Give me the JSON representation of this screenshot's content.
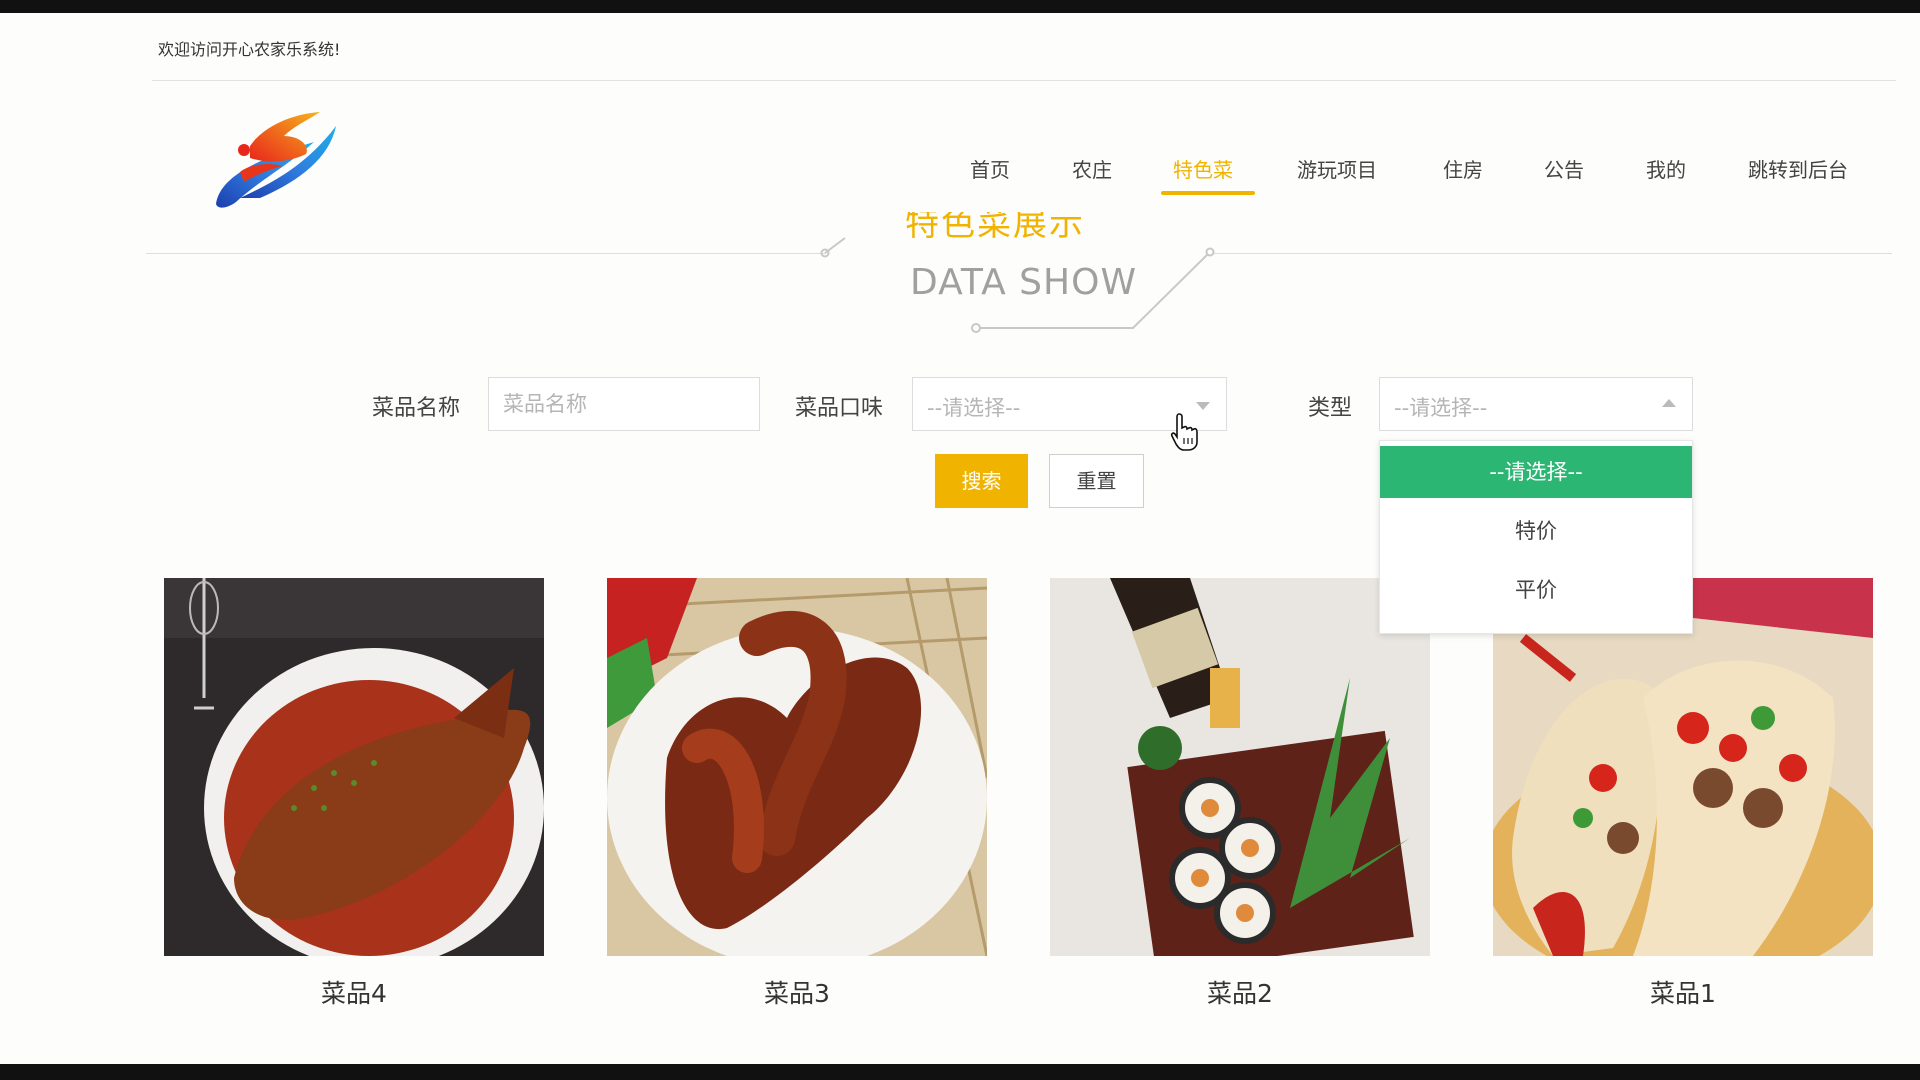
{
  "header": {
    "welcome": "欢迎访问开心农家乐系统!"
  },
  "nav": {
    "items": [
      {
        "label": "首页",
        "active": false
      },
      {
        "label": "农庄",
        "active": false
      },
      {
        "label": "特色菜",
        "active": true
      },
      {
        "label": "游玩项目",
        "active": false
      },
      {
        "label": "住房",
        "active": false
      },
      {
        "label": "公告",
        "active": false
      },
      {
        "label": "我的",
        "active": false
      },
      {
        "label": "跳转到后台",
        "active": false
      }
    ],
    "accent_color": "#f0b400"
  },
  "section": {
    "title": "特色菜展示",
    "subtitle": "DATA SHOW"
  },
  "search": {
    "name_label": "菜品名称",
    "name_placeholder": "菜品名称",
    "taste_label": "菜品口味",
    "taste_value": "--请选择--",
    "type_label": "类型",
    "type_value": "--请选择--",
    "search_button": "搜索",
    "reset_button": "重置"
  },
  "type_dropdown": {
    "open": true,
    "options": [
      "--请选择--",
      "特价",
      "平价"
    ],
    "selected_index": 0,
    "selected_color": "#2bb673"
  },
  "dishes": [
    {
      "name": "菜品4",
      "image": "braised-fish-photo"
    },
    {
      "name": "菜品3",
      "image": "braised-duck-neck-photo"
    },
    {
      "name": "菜品2",
      "image": "sushi-platter-photo"
    },
    {
      "name": "菜品1",
      "image": "tacos-photo"
    }
  ]
}
